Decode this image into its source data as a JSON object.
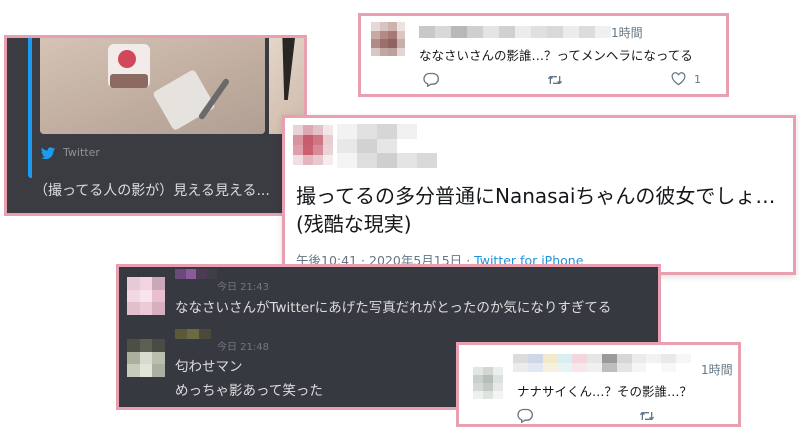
{
  "embed": {
    "source_label": "Twitter",
    "caption": "（撮ってる人の影が）見える見える..."
  },
  "reply_top": {
    "time": "1時間",
    "text": "ななさいさんの影誰…？ってメンヘラになってる",
    "like_count": "1"
  },
  "main_tweet": {
    "line1": "撮ってるの多分普通にNanasaiちゃんの彼女でしょ…",
    "line2": "(残酷な現実)",
    "time": "午後10:41",
    "separator": "·",
    "date": "2020年5月15日",
    "client": "Twitter for iPhone"
  },
  "chat": {
    "messages": [
      {
        "timestamp": "今日 21:43",
        "text": "ななさいさんがTwitterにあげた写真だれがとったのか気になりすぎてる"
      },
      {
        "timestamp": "今日 21:48",
        "text": "匂わせマン"
      },
      {
        "text": "めっちゃ影あって笑った"
      }
    ]
  },
  "reply_bottom": {
    "time": "1時間",
    "text": "ナナサイくん…？その影誰…？"
  },
  "colors": {
    "card_border": "#e8a0b0",
    "twitter_blue": "#1d9bf0",
    "discord_bg": "#36393f",
    "tweet_text": "#14171a",
    "muted_gray": "#657786"
  },
  "icons": [
    "twitter-bird-icon",
    "reply-icon",
    "retweet-icon",
    "like-icon"
  ]
}
